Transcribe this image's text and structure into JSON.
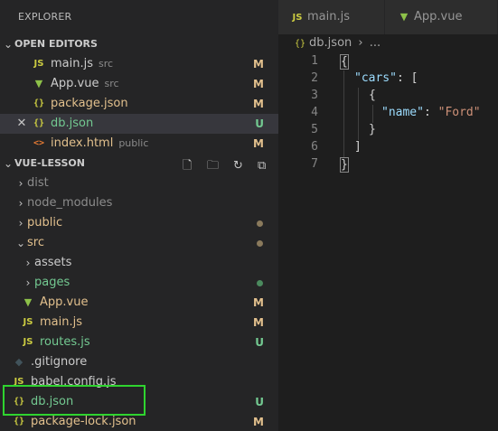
{
  "explorer": {
    "title": "EXPLORER",
    "open_editors": {
      "header": "OPEN EDITORS",
      "items": [
        {
          "name": "main.js",
          "desc": "src",
          "badge": "M",
          "icon": "js-icon"
        },
        {
          "name": "App.vue",
          "desc": "src",
          "badge": "M",
          "icon": "vue-icon"
        },
        {
          "name": "package.json",
          "desc": "",
          "badge": "M",
          "icon": "json-icon"
        },
        {
          "name": "db.json",
          "desc": "",
          "badge": "U",
          "icon": "json-icon"
        },
        {
          "name": "index.html",
          "desc": "public",
          "badge": "M",
          "icon": "html-icon"
        }
      ]
    },
    "project": {
      "header": "VUE-LESSON",
      "tree": [
        {
          "name": "dist",
          "type": "folder"
        },
        {
          "name": "node_modules",
          "type": "folder"
        },
        {
          "name": "public",
          "type": "folder"
        },
        {
          "name": "src",
          "type": "folder"
        },
        {
          "name": "assets",
          "type": "folder"
        },
        {
          "name": "pages",
          "type": "folder"
        },
        {
          "name": "App.vue",
          "badge": "M"
        },
        {
          "name": "main.js",
          "badge": "M"
        },
        {
          "name": "routes.js",
          "badge": "U"
        },
        {
          "name": ".gitignore"
        },
        {
          "name": "babel.config.js"
        },
        {
          "name": "db.json",
          "badge": "U"
        },
        {
          "name": "package-lock.json",
          "badge": "M"
        }
      ]
    }
  },
  "editor": {
    "tabs": [
      {
        "label": "main.js",
        "icon": "js-icon"
      },
      {
        "label": "App.vue",
        "icon": "vue-icon"
      }
    ],
    "breadcrumb": {
      "file": "db.json",
      "separator": "›",
      "rest": "..."
    },
    "line_numbers": [
      "1",
      "2",
      "3",
      "4",
      "5",
      "6",
      "7"
    ],
    "code": {
      "l1": "{",
      "l2_key": "\"cars\"",
      "l2_rest": ": [",
      "l3": "{",
      "l4_key": "\"name\"",
      "l4_colon": ": ",
      "l4_val": "\"Ford\"",
      "l5": "}",
      "l6": "]",
      "l7": "}"
    }
  },
  "colors": {
    "modified": "#e2c08d",
    "untracked": "#73c991",
    "highlight_box": "#2fd42f"
  }
}
